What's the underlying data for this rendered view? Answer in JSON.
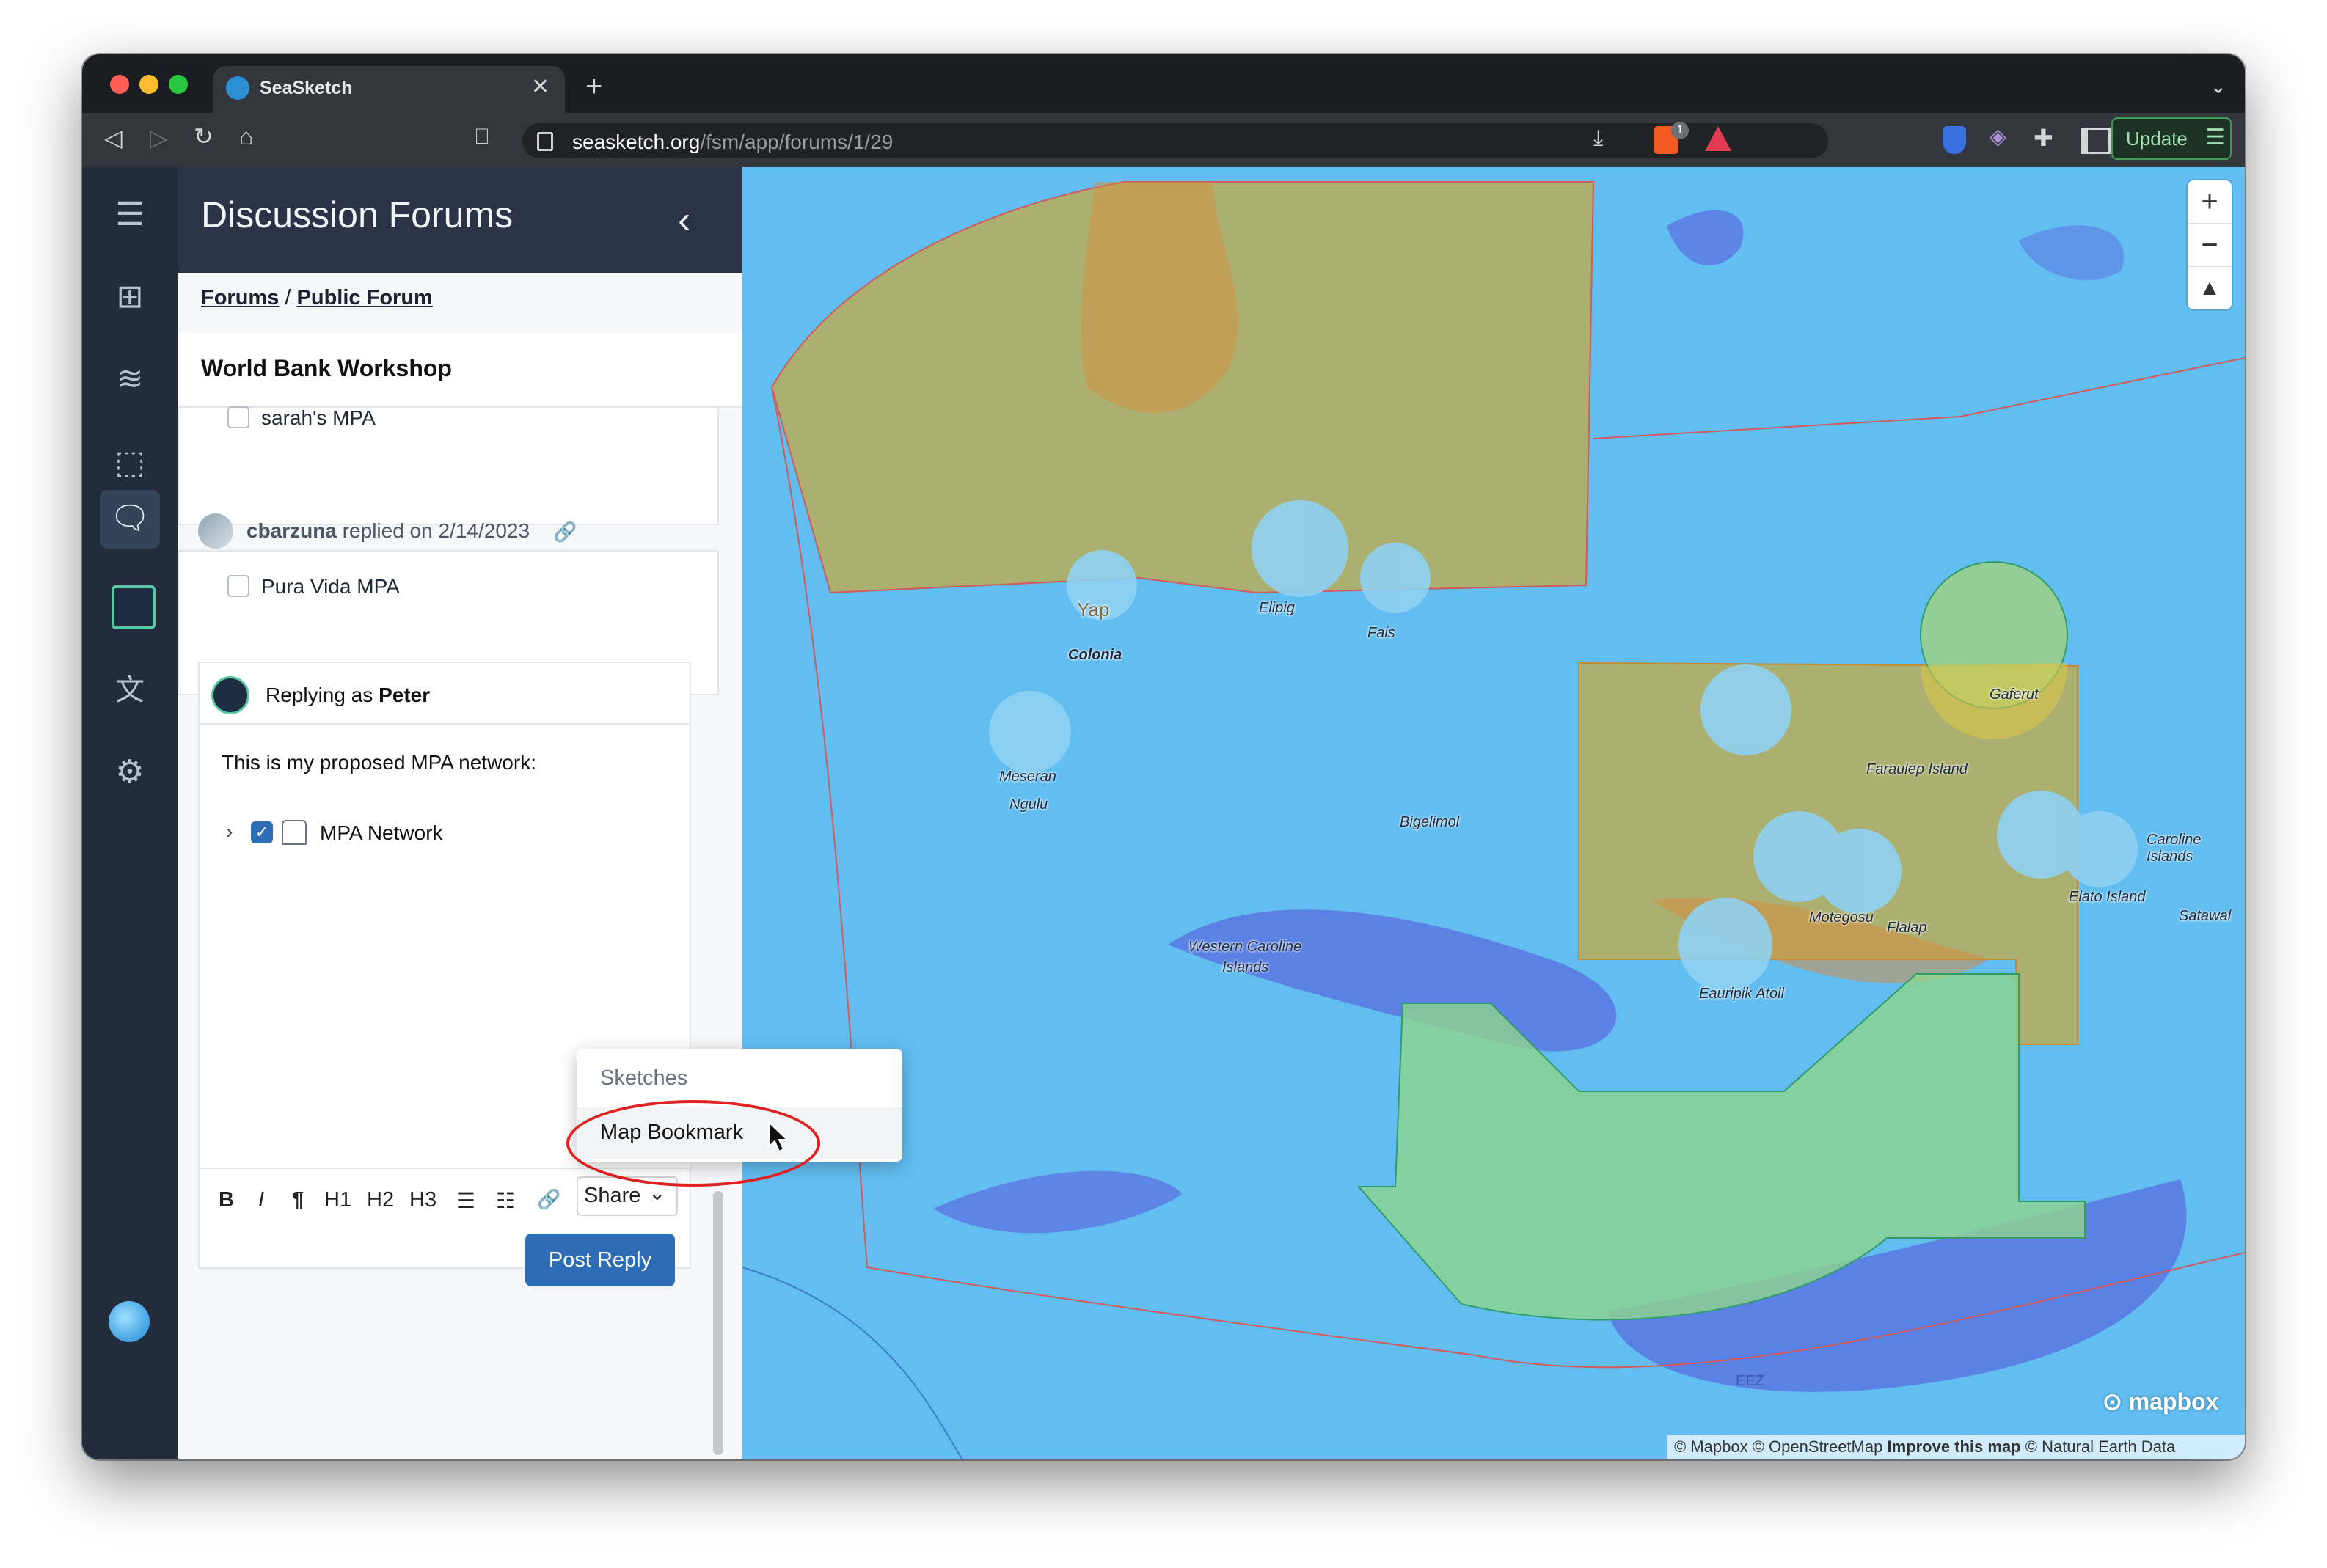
{
  "browser": {
    "tab_title": "SeaSketch",
    "url_host": "seasketch.org",
    "url_path": "/fsm/app/forums/1/29",
    "update_label": "Update",
    "shield_badge": "1"
  },
  "sidebar_icons": [
    "menu-icon",
    "map-icon",
    "layers-icon",
    "sketch-icon",
    "forum-icon",
    "avatar-icon",
    "translate-icon",
    "settings-icon",
    "seasketch-logo-icon"
  ],
  "panel": {
    "title": "Discussion Forums",
    "breadcrumb_root": "Forums",
    "breadcrumb_sep": "/",
    "breadcrumb_current": "Public Forum",
    "topic_title": "World Bank Workshop"
  },
  "posts": [
    {
      "item_label": "sarah's MPA"
    },
    {
      "author": "cbarzuna",
      "replied_text": "replied on 2/14/2023",
      "item_label": "Pura Vida MPA"
    }
  ],
  "reply": {
    "replying_prefix": "Replying as",
    "user": "Peter",
    "body_text": "This is my proposed MPA network:",
    "attachment_label": "MPA Network",
    "toolbar": [
      "B",
      "I",
      "¶",
      "H1",
      "H2",
      "H3"
    ],
    "share_label": "Share",
    "post_button": "Post Reply"
  },
  "share_menu": {
    "items": [
      "Sketches",
      "Map Bookmark"
    ]
  },
  "map": {
    "labels": {
      "yap": "Yap",
      "colonia": "Colonia",
      "elipig": "Elipig",
      "fais": "Fais",
      "meseran": "Meseran",
      "ngulu": "Ngulu",
      "gaferut": "Gaferut",
      "faraulep": "Faraulep Island",
      "bigelimol": "Bigelimol",
      "caroline": "Caroline Islands",
      "elato": "Elato Island",
      "satawal": "Satawal",
      "motegosu": "Motegosu",
      "flalap": "Flalap",
      "western1": "Western Caroline",
      "western2": "Islands",
      "eauripik": "Eauripik Atoll",
      "eez": "EEZ"
    },
    "mapbox_label": "mapbox",
    "attribution_1": "© Mapbox © OpenStreetMap",
    "attribution_2": "Improve this map",
    "attribution_3": "© Natural Earth Data"
  }
}
